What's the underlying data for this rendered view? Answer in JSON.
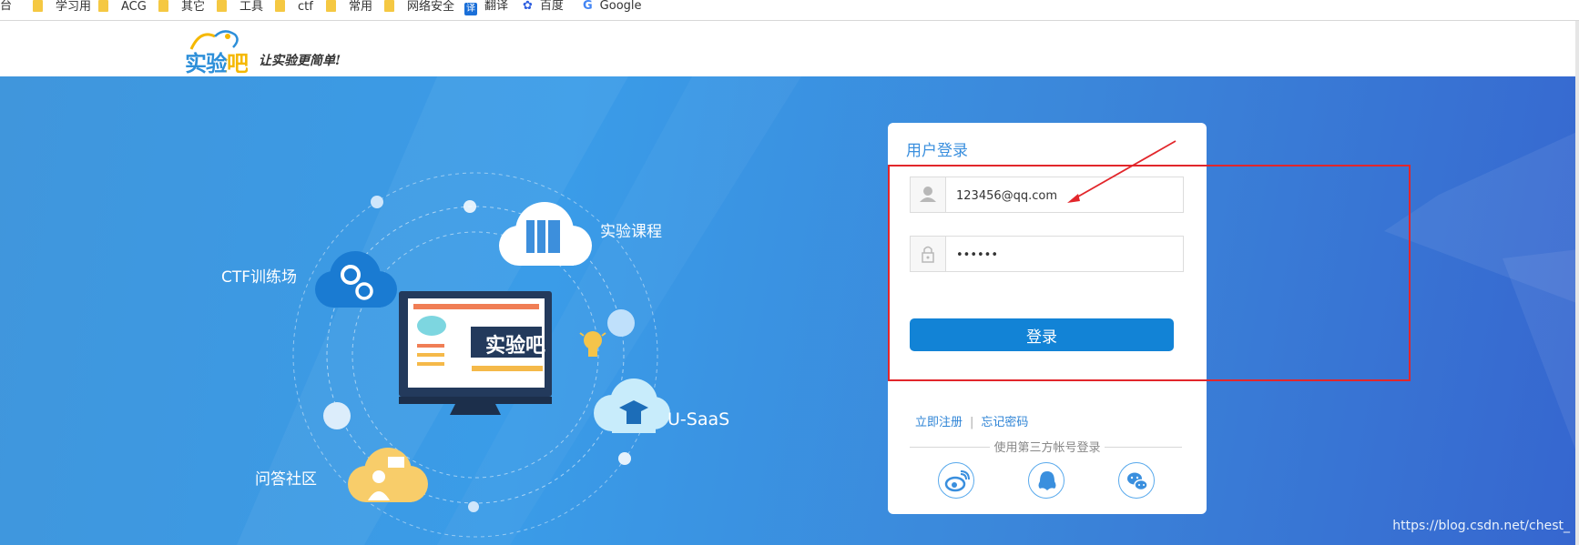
{
  "bookmarks": {
    "partial": "平台",
    "items": [
      "学习用",
      "ACG",
      "其它",
      "工具",
      "ctf",
      "常用",
      "网络安全"
    ],
    "translate": "翻译",
    "baidu": "百度",
    "google": "Google"
  },
  "header": {
    "logo": "实验吧",
    "slogan": "让实验更简单!"
  },
  "hero": {
    "screen_label": "实验吧",
    "labels": {
      "courses": "实验课程",
      "ctf": "CTF训练场",
      "usaas": "U-SaaS",
      "qa": "问答社区"
    }
  },
  "login": {
    "title": "用户登录",
    "username": "123456@qq.com",
    "password": "••••••",
    "submit": "登录",
    "register": "立即注册",
    "forgot": "忘记密码",
    "third_party": "使用第三方帐号登录",
    "social": [
      "weibo-icon",
      "qq-icon",
      "wechat-icon"
    ]
  },
  "watermark": "https://blog.csdn.net/chest_",
  "colors": {
    "brand_blue": "#1283d6",
    "annotation_red": "#e2262b",
    "folder_yellow": "#f5c842"
  }
}
